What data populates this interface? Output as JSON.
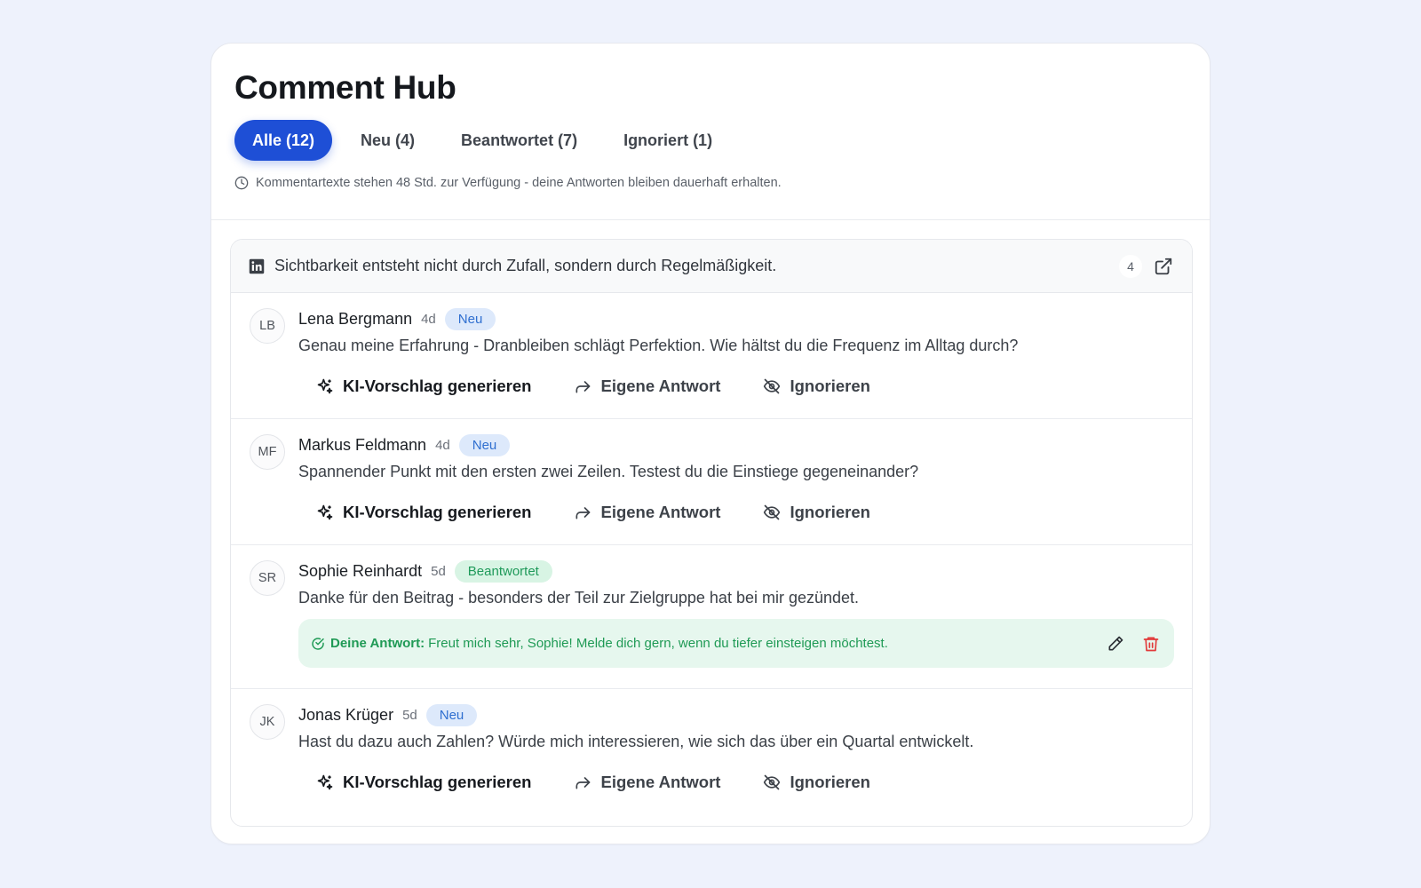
{
  "page": {
    "title": "Comment Hub",
    "info_text": "Kommentartexte stehen 48 Std. zur Verfügung - deine Antworten bleiben dauerhaft erhalten."
  },
  "tabs": [
    {
      "label": "Alle (12)",
      "active": true
    },
    {
      "label": "Neu (4)",
      "active": false
    },
    {
      "label": "Beantwortet (7)",
      "active": false
    },
    {
      "label": "Ignoriert (1)",
      "active": false
    }
  ],
  "post": {
    "network_icon": "linkedin-icon",
    "title": "Sichtbarkeit entsteht nicht durch Zufall, sondern durch Regelmäßigkeit.",
    "count": "4"
  },
  "actions": {
    "ai_label": "KI-Vorschlag generieren",
    "own_label": "Eigene Antwort",
    "ignore_label": "Ignorieren"
  },
  "comments": [
    {
      "initials": "LB",
      "author": "Lena Bergmann",
      "age": "4d",
      "status": "Neu",
      "text": "Genau meine Erfahrung - Dranbleiben schlägt Perfektion. Wie hältst du die Frequenz im Alltag durch?"
    },
    {
      "initials": "MF",
      "author": "Markus Feldmann",
      "age": "4d",
      "status": "Neu",
      "text": "Spannender Punkt mit den ersten zwei Zeilen. Testest du die Einstiege gegeneinander?"
    },
    {
      "initials": "SR",
      "author": "Sophie Reinhardt",
      "age": "5d",
      "status": "Beantwortet",
      "text": "Danke für den Beitrag - besonders der Teil zur Zielgruppe hat bei mir gezündet.",
      "reply_label": "Deine Antwort:",
      "reply_text": "Freut mich sehr, Sophie! Melde dich gern, wenn du tiefer einsteigen möchtest."
    },
    {
      "initials": "JK",
      "author": "Jonas Krüger",
      "age": "5d",
      "status": "Neu",
      "text": "Hast du dazu auch Zahlen? Würde mich interessieren, wie sich das über ein Quartal entwickelt."
    }
  ],
  "colors": {
    "background": "#eef2fc",
    "accent": "#1e4fd6",
    "badge_new_bg": "#dde9fb",
    "badge_new_text": "#2f6fd0",
    "badge_done_bg": "#d8f4e4",
    "badge_done_text": "#1f9a5a",
    "reply_bg": "#e6f7ee",
    "delete_red": "#e23b3b"
  }
}
